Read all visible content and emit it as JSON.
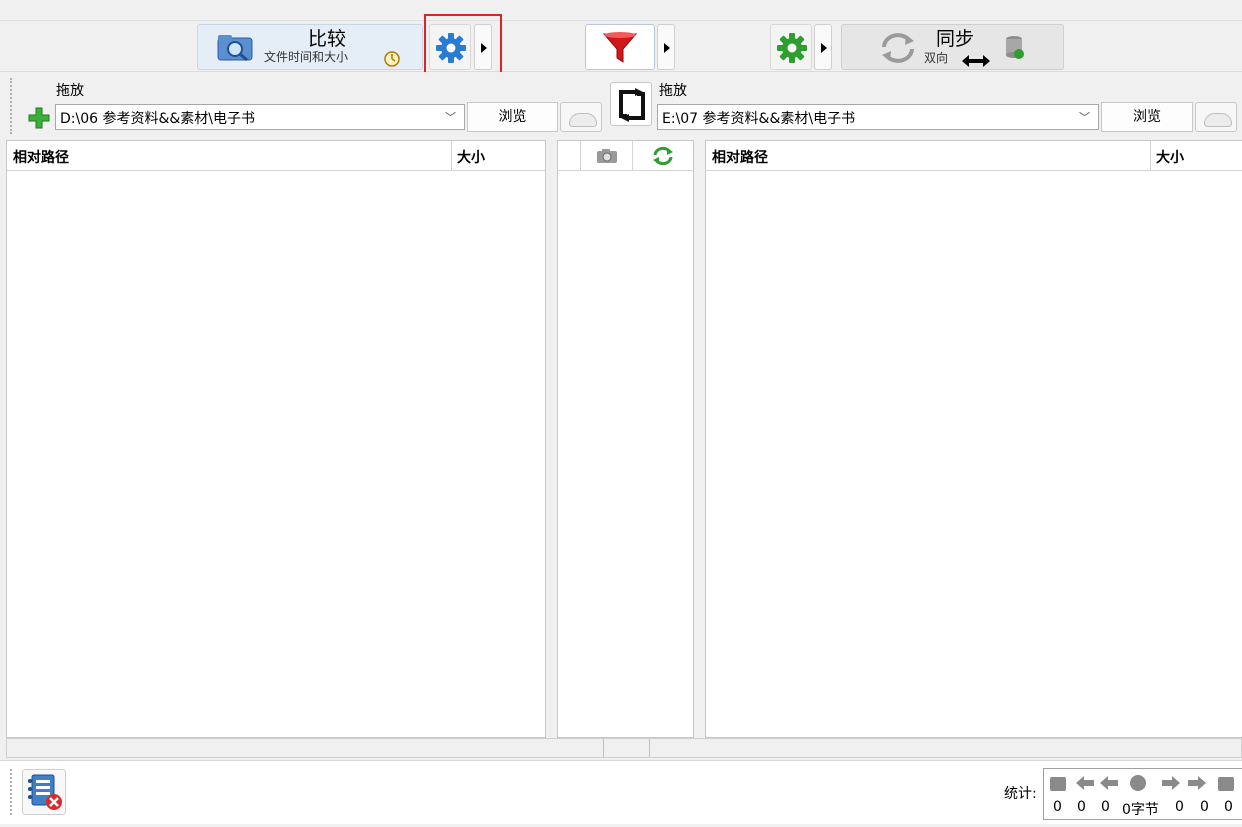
{
  "toolbar": {
    "compare": {
      "title": "比较",
      "subtitle": "文件时间和大小"
    },
    "sync": {
      "title": "同步",
      "subtitle": "双向"
    }
  },
  "folders": {
    "left": {
      "drop_label": "拖放",
      "path": "D:\\06 参考资料&&素材\\电子书",
      "browse_label": "浏览"
    },
    "right": {
      "drop_label": "拖放",
      "path": "E:\\07 参考资料&&素材\\电子书",
      "browse_label": "浏览"
    }
  },
  "grid": {
    "left": {
      "col_path": "相对路径",
      "col_size": "大小"
    },
    "right": {
      "col_path": "相对路径",
      "col_size": "大小"
    }
  },
  "stats": {
    "label": "统计:",
    "values": [
      "0",
      "0",
      "0",
      "0字节",
      "0",
      "0",
      "0"
    ]
  },
  "colors": {
    "highlight": "#e0202a",
    "blue_icon": "#2a7bd4",
    "green_icon": "#2e9e2e",
    "red_filter": "#d01818"
  },
  "icons": [
    "compare-icon",
    "clock-icon",
    "gear-icon",
    "filter-icon",
    "sync-icon",
    "database-icon",
    "add-icon",
    "swap-icon",
    "cloud-icon",
    "camera-icon",
    "refresh-icon",
    "log-icon"
  ]
}
